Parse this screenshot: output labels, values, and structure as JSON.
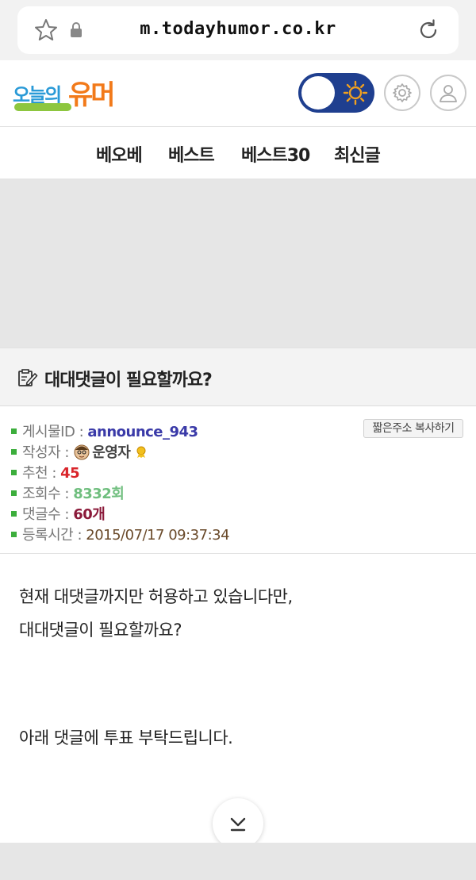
{
  "browser": {
    "url": "m.todayhumor.co.kr"
  },
  "header": {
    "logo_part1": "오늘의",
    "logo_part2": "유머"
  },
  "nav": {
    "items": [
      "베오베",
      "베스트",
      "베스트30",
      "최신글"
    ]
  },
  "post": {
    "title": "대대댓글이 필요할까요?",
    "copy_button": "짧은주소 복사하기",
    "info": {
      "id_label": "게시물ID : ",
      "id_value": "announce_943",
      "author_label": "작성자 : ",
      "author_value": "운영자",
      "rec_label": "추천 : ",
      "rec_value": "45",
      "views_label": "조회수 : ",
      "views_value": "8332회",
      "comments_label": "댓글수 : ",
      "comments_value": "60개",
      "date_label": "등록시간 : ",
      "date_value": "2015/07/17 09:37:34"
    },
    "body": {
      "line1": "현재 대댓글까지만 허용하고 있습니다만,",
      "line2": "대대댓글이 필요할까요?",
      "line3": "아래 댓글에 투표 부탁드립니다."
    }
  },
  "colors": {
    "toggle": "#1f3f8f",
    "recommend": "#d9242a",
    "views": "#6fbe7e",
    "comments": "#8b1a3a",
    "post_id": "#3a3aa8"
  }
}
